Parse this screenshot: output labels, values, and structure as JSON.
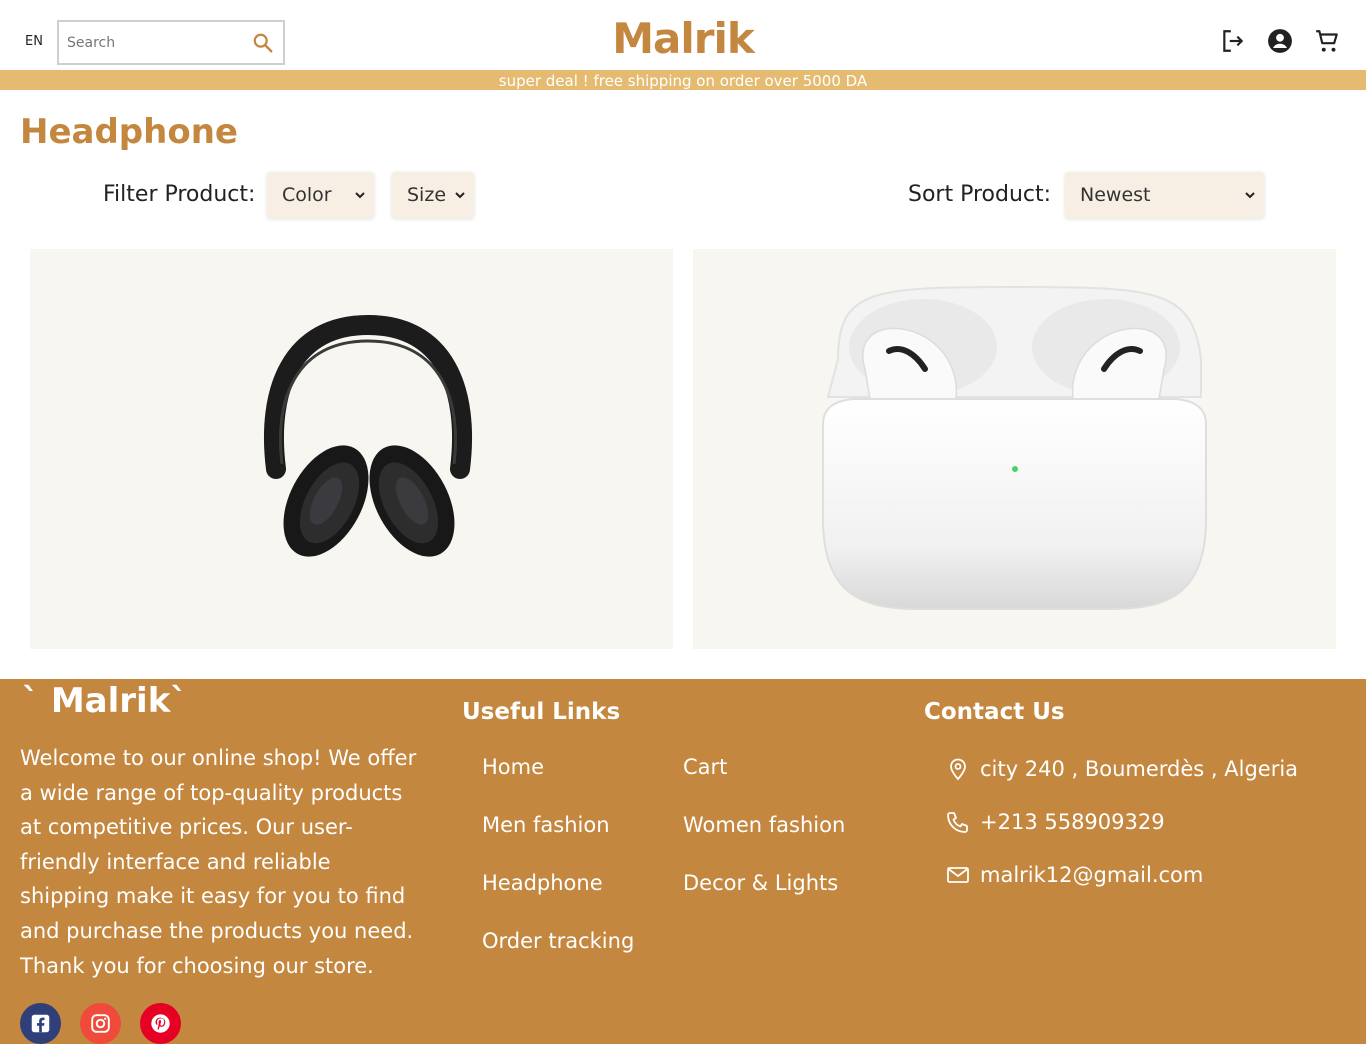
{
  "header": {
    "language": "EN",
    "search_placeholder": "Search",
    "logo": "Malrik",
    "icons": [
      "logout-icon",
      "account-icon",
      "cart-icon"
    ]
  },
  "banner": {
    "text": "super deal ! free shipping on order over 5000 DA"
  },
  "page": {
    "title": "Headphone",
    "filter_label": "Filter Product:",
    "filter_color": "Color",
    "filter_size": "Size",
    "sort_label": "Sort Product:",
    "sort_value": "Newest"
  },
  "products": [
    {
      "image": "black over-ear headphones"
    },
    {
      "image": "white wireless earbuds in open charging case"
    }
  ],
  "footer": {
    "brand": "` Malrik`",
    "about": "Welcome to our online shop! We offer a wide range of top-quality products at competitive prices. Our user-friendly interface and reliable shipping make it easy for you to find and purchase the products you need. Thank you for choosing our store.",
    "links_heading": "Useful Links",
    "links": [
      "Home",
      "Cart",
      "Men fashion",
      "Women fashion",
      "Headphone",
      "Decor & Lights",
      "Order tracking"
    ],
    "contact_heading": "Contact Us",
    "address": "city 240 , Boumerdès , Algeria",
    "phone": "+213 558909329",
    "email": "malrik12@gmail.com",
    "social": [
      {
        "name": "facebook-icon",
        "color": "#3b5998"
      },
      {
        "name": "instagram-icon",
        "color": "#e1306c"
      },
      {
        "name": "pinterest-icon",
        "color": "#e60023"
      }
    ]
  },
  "colors": {
    "brand": "#c4873f",
    "banner": "#e5bb72",
    "card": "#f8f6f0",
    "select": "#f8efe4"
  }
}
